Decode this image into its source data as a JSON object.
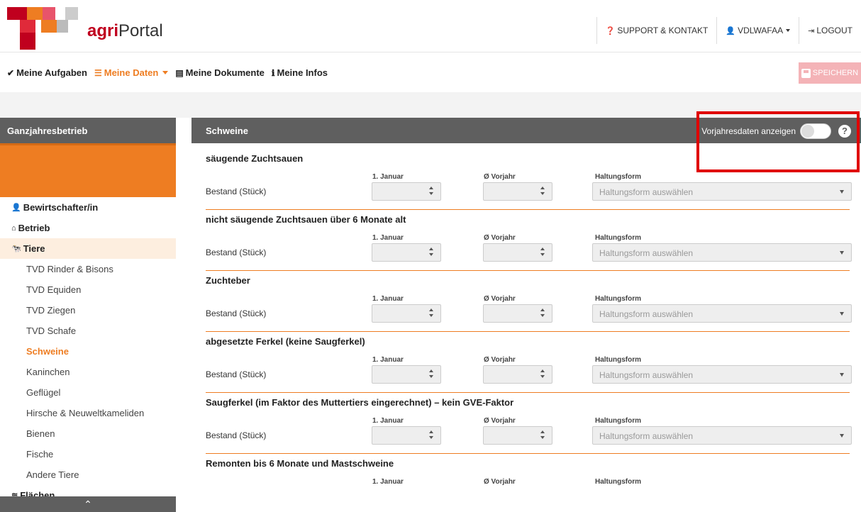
{
  "brand": {
    "name_prefix": "agri",
    "name_suffix": "Portal"
  },
  "top_links": {
    "support": "SUPPORT & KONTAKT",
    "user": "VDLWAFAA",
    "logout": "LOGOUT"
  },
  "nav": {
    "items": [
      "Meine Aufgaben",
      "Meine Daten",
      "Meine Dokumente",
      "Meine Infos"
    ],
    "save": "SPEICHERN"
  },
  "sidebar": {
    "title": "Ganzjahresbetrieb",
    "items": [
      "Bewirtschafter/in",
      "Betrieb",
      "Tiere",
      "Flächen"
    ],
    "sub_items": [
      "TVD Rinder & Bisons",
      "TVD Equiden",
      "TVD Ziegen",
      "TVD Schafe",
      "Schweine",
      "Kaninchen",
      "Geflügel",
      "Hirsche & Neuweltkameliden",
      "Bienen",
      "Fische",
      "Andere Tiere"
    ]
  },
  "main": {
    "title": "Schweine",
    "toggle_label": "Vorjahresdaten anzeigen",
    "help": "?",
    "col_jan": "1. Januar",
    "col_prev": "Ø Vorjahr",
    "col_form": "Haltungsform",
    "row_label": "Bestand (Stück)",
    "select_placeholder": "Haltungsform auswählen",
    "sections": [
      "säugende Zuchtsauen",
      "nicht säugende Zuchtsauen über 6 Monate alt",
      "Zuchteber",
      "abgesetzte Ferkel (keine Saugferkel)",
      "Saugferkel (im Faktor des Muttertiers eingerechnet) – kein GVE-Faktor",
      "Remonten bis 6 Monate und Mastschweine"
    ]
  },
  "colors": {
    "accent": "#ee7d22",
    "brand_red": "#c0001e",
    "header_gray": "#5f5f5f",
    "highlight": "#e00000"
  }
}
